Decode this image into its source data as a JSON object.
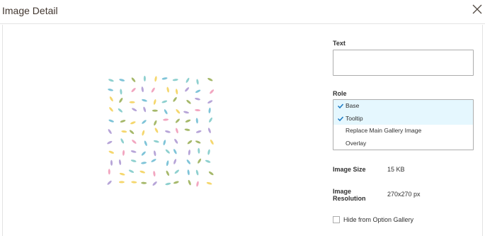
{
  "header": {
    "title": "Image Detail"
  },
  "form": {
    "text_label": "Text",
    "text_value": "",
    "role_label": "Role",
    "roles": [
      {
        "label": "Base",
        "selected": true
      },
      {
        "label": "Tooltip",
        "selected": true
      },
      {
        "label": "Replace Main Gallery Image",
        "selected": false
      },
      {
        "label": "Overlay",
        "selected": false
      }
    ],
    "size_label": "Image Size",
    "size_value": "15 KB",
    "resolution_label_1": "Image",
    "resolution_label_2": "Resolution",
    "resolution_value": "270x270 px",
    "hide_label": "Hide from Option Gallery",
    "hide_checked": false
  },
  "colors": {
    "selected_bg": "#e5f7fe",
    "check": "#1979c3",
    "sprinkles": [
      "#b7a5d8",
      "#8ed0cf",
      "#f5d76e",
      "#f2a6c0",
      "#a5b86a",
      "#7fc4d8"
    ]
  }
}
